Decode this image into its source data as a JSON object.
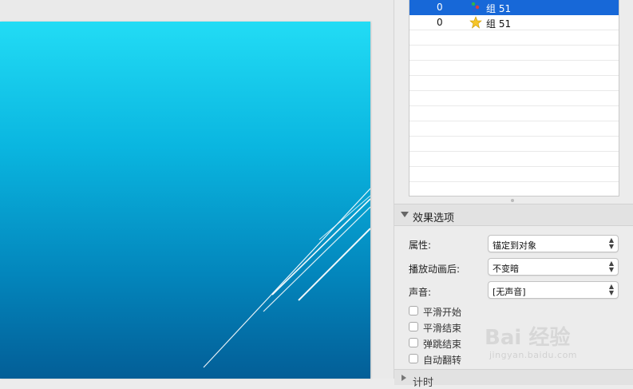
{
  "animation_list": {
    "rows": [
      {
        "order": "0",
        "icon": "motion-path-icon",
        "name": "组 51",
        "selected": true
      },
      {
        "order": "0",
        "icon": "star-emphasis-icon",
        "name": "组 51",
        "selected": false
      }
    ],
    "empty_rows": 10
  },
  "effect_options": {
    "title": "效果选项",
    "properties": [
      {
        "label": "属性:",
        "value": "锚定到对象"
      },
      {
        "label": "播放动画后:",
        "value": "不变暗"
      },
      {
        "label": "声音:",
        "value": "[无声音]"
      }
    ],
    "checkboxes": [
      {
        "label": "平滑开始",
        "checked": false
      },
      {
        "label": "平滑结束",
        "checked": false
      },
      {
        "label": "弹跳结束",
        "checked": false
      },
      {
        "label": "自动翻转",
        "checked": false
      }
    ]
  },
  "timing_section": {
    "title": "计时"
  },
  "watermark": {
    "logo_text": "Bai 经验",
    "url": "jingyan.baidu.com"
  },
  "colors": {
    "selection": "#1768d8",
    "slide_top": "#22dcf5",
    "slide_bottom": "#035e97"
  }
}
